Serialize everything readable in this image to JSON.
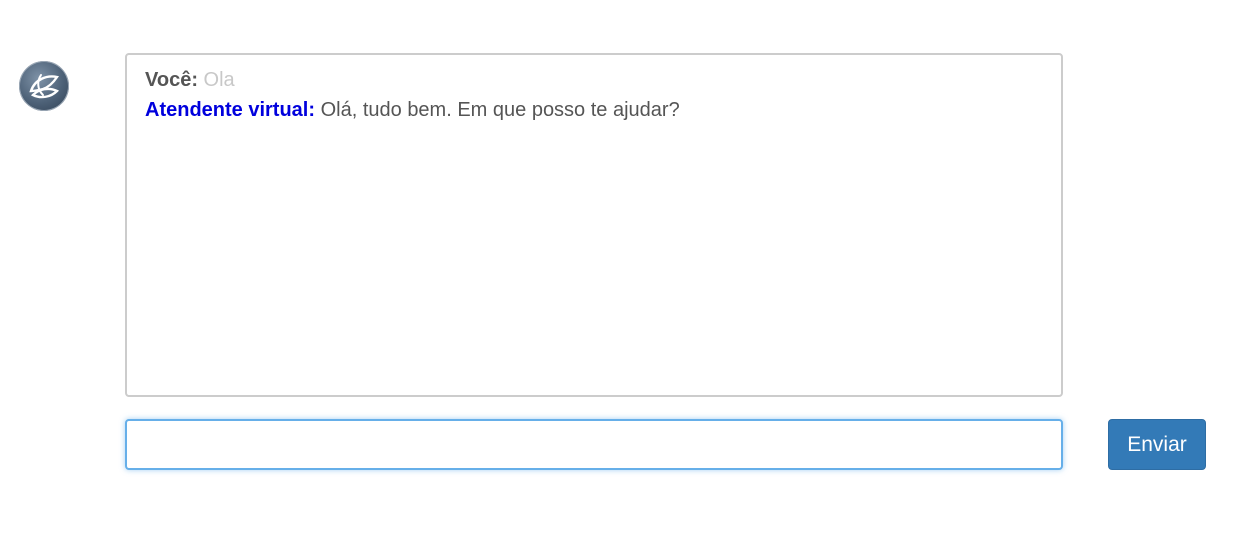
{
  "avatar": {
    "icon": "leaf-logo-icon"
  },
  "chat": {
    "messages": [
      {
        "speaker": "Você:",
        "text": "Ola"
      },
      {
        "speaker": "Atendente virtual:",
        "text": "Olá, tudo bem. Em que posso te ajudar?"
      }
    ]
  },
  "input": {
    "value": "",
    "placeholder": ""
  },
  "send_button": {
    "label": "Enviar"
  },
  "colors": {
    "bot_speaker": "#0000dd",
    "user_text": "#c8c8c8",
    "button": "#337ab7",
    "input_focus": "#66afe9"
  }
}
